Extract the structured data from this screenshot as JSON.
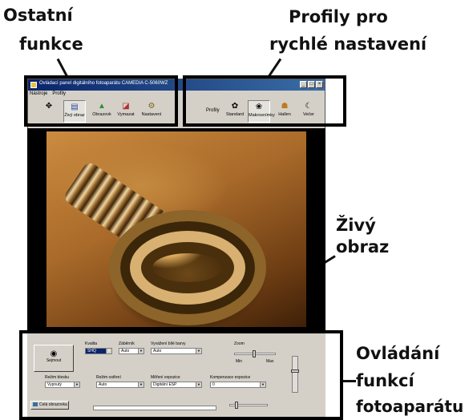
{
  "callouts": {
    "left_top": [
      "Ostatní",
      "funkce"
    ],
    "right_top": [
      "Profily pro",
      "rychlé nastavení"
    ],
    "live": [
      "Živý",
      "obraz"
    ],
    "bottom": [
      "Ovládání",
      "funkcí",
      "fotoaparátu"
    ]
  },
  "window": {
    "title": "Ovládací panel digitálního fotoaparátu CAMEDIA C-5060WZ",
    "menu": [
      "Nástroje",
      "Profily"
    ],
    "controls": [
      "_",
      "□",
      "×"
    ]
  },
  "toolbar_left": {
    "buttons": [
      {
        "label": "",
        "icon": "arrow-icon"
      },
      {
        "label": "Živý obraz",
        "icon": "live-view-icon",
        "pressed": true
      },
      {
        "label": "Obrazovk",
        "icon": "image-icon"
      },
      {
        "label": "Vymazat",
        "icon": "delete-icon"
      },
      {
        "label": "Nastavení",
        "icon": "settings-icon"
      }
    ]
  },
  "toolbar_right": {
    "label": "Profily",
    "buttons": [
      {
        "label": "Standard",
        "icon": "standard-profile-icon"
      },
      {
        "label": "Makrosnímky",
        "icon": "macro-profile-icon",
        "pressed": true
      },
      {
        "label": "Hallen",
        "icon": "indoor-profile-icon"
      },
      {
        "label": "Večer",
        "icon": "night-profile-icon"
      }
    ]
  },
  "panel": {
    "snap_label": "Sejmout",
    "fields": {
      "quality": {
        "label": "Kvalita",
        "value": "SHQ"
      },
      "format": {
        "label": "Záběrník",
        "value": "Auto"
      },
      "white_balance": {
        "label": "Vyvážení bílé barvy",
        "value": "Auto"
      },
      "zoom": {
        "label": "Zoom"
      },
      "flash_mode": {
        "label": "Režim blesku",
        "value": "Vypnutý"
      },
      "focus_mode": {
        "label": "Režim ostření",
        "value": "Auto"
      },
      "metering": {
        "label": "Měření expozice",
        "value": "Digitální ESP"
      },
      "exposure_comp": {
        "label": "Kompenzace expozice",
        "value": "0"
      },
      "min_label": "Min",
      "max_label": "Max"
    },
    "full_screen_label": "Celá obrazovka"
  }
}
